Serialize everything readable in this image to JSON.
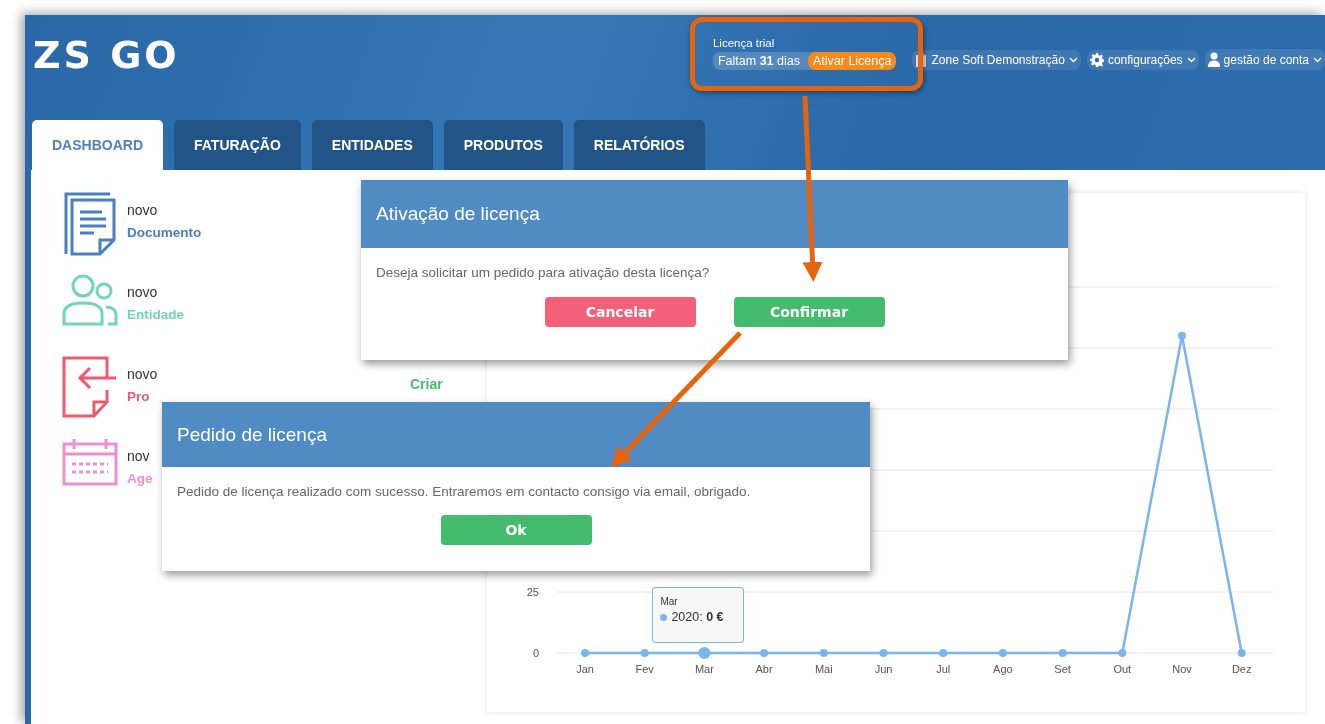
{
  "header": {
    "logo": "ZS GO",
    "license": {
      "label": "Licença trial",
      "remaining": "Faltam **31** dias",
      "action": "Ativar Licença"
    },
    "menu": [
      {
        "label": "Zone Soft Demonstração",
        "kind": "company"
      },
      {
        "label": "configurações",
        "kind": "settings"
      },
      {
        "label": "gestão de conta",
        "kind": "account"
      }
    ]
  },
  "tabs": [
    {
      "label": "DASHBOARD",
      "selected": true
    },
    {
      "label": "FATURAÇÃO",
      "selected": false
    },
    {
      "label": "ENTIDADES",
      "selected": false
    },
    {
      "label": "PRODUTOS",
      "selected": false
    },
    {
      "label": "RELATÓRIOS",
      "selected": false
    }
  ],
  "shortcuts": [
    {
      "kind": "document",
      "action": "novo",
      "label": "Documento",
      "color": "#4a7fc1"
    },
    {
      "kind": "people",
      "action": "novo",
      "label": "Entidade",
      "color": "#6fd6b8"
    },
    {
      "kind": "import",
      "action": "novo",
      "label": "Pro",
      "color": "#f0596e",
      "link": "Criar"
    },
    {
      "kind": "calendar",
      "action": "nov",
      "label": "Age",
      "color": "#ee8fcf"
    }
  ],
  "chart": {
    "chart_data": {
      "type": "line",
      "categories": [
        "Jan",
        "Fev",
        "Mar",
        "Abr",
        "Mai",
        "Jun",
        "Jul",
        "Ago",
        "Set",
        "Out",
        "Nov",
        "Dez"
      ],
      "series": [
        {
          "name": "2020",
          "color": "#7cb5ec",
          "marker": "circle",
          "values": [
            0,
            0,
            0,
            0,
            0,
            0,
            0,
            0,
            0,
            0,
            130,
            0
          ]
        }
      ],
      "ylim": [
        0,
        150
      ],
      "yticks": [
        0,
        25
      ]
    },
    "tooltip": {
      "title": "Mar",
      "text": ": **0 €**"
    }
  },
  "dialogs": [
    {
      "title": "Ativação de licença",
      "message": "Deseja solicitar um pedido para ativação desta licença?",
      "buttons": [
        {
          "label": "Cancelar",
          "kind": "cancel"
        },
        {
          "label": "Confirmar",
          "kind": "confirm"
        }
      ]
    },
    {
      "title": "Pedido de licença",
      "message": "Pedido de licença realizado com sucesso. Entraremos em contacto consigo via email, obrigado.",
      "buttons": [
        {
          "label": "Ok",
          "kind": "confirm"
        }
      ]
    }
  ]
}
